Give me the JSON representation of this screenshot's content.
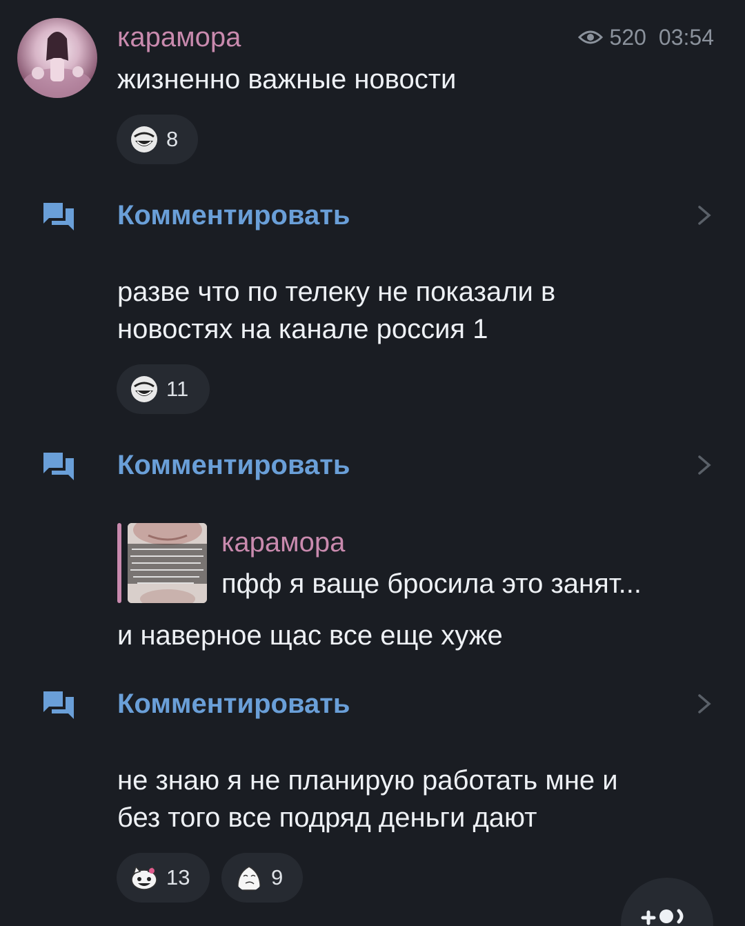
{
  "header": {
    "author": "карамора",
    "views": "520",
    "time": "03:54"
  },
  "messages": [
    {
      "text": "жизненно важные новости",
      "reactions": [
        {
          "icon": "trollface-icon",
          "count": "8"
        }
      ],
      "comment_label": "Комментировать"
    },
    {
      "text": "разве что по телеку не показали в\nновостях на канале россия 1",
      "reactions": [
        {
          "icon": "trollface-icon",
          "count": "11"
        }
      ],
      "comment_label": "Комментировать"
    },
    {
      "reply": {
        "author": "карамора",
        "text": "пфф я ваще бросила это занят..."
      },
      "text": "и наверное щас все еще хуже",
      "comment_label": "Комментировать"
    },
    {
      "text": "не знаю я не планирую работать мне и\nбез того все подряд деньги дают",
      "reactions": [
        {
          "icon": "hello-kitty-icon",
          "count": "13"
        },
        {
          "icon": "rage-face-icon",
          "count": "9"
        }
      ]
    }
  ],
  "colors": {
    "background": "#1a1d23",
    "author": "#c98aae",
    "link": "#6a9fd8",
    "muted": "#8b929c",
    "pill": "#262a31"
  }
}
